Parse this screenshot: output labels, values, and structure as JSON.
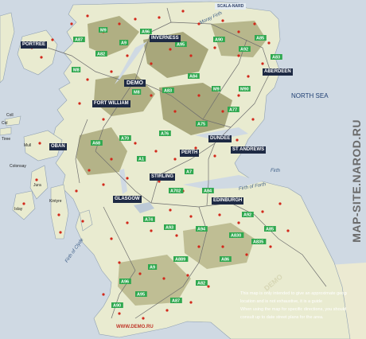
{
  "map": {
    "colors": {
      "sea": "#cfd9e3",
      "land": "#e9ebd0",
      "highland": "#9c9b6c",
      "road_label": "#2fa84f",
      "town_dot": "#d2281b",
      "city_label": "#1e2a44"
    },
    "cities": [
      {
        "id": "portree",
        "name": "PORTREE"
      },
      {
        "id": "inverness",
        "name": "INVERNESS"
      },
      {
        "id": "aberdeen",
        "name": "ABERDEEN"
      },
      {
        "id": "fort-william",
        "name": "FORT WILLIAM"
      },
      {
        "id": "oban",
        "name": "OBAN"
      },
      {
        "id": "perth",
        "name": "PERTH"
      },
      {
        "id": "dundee",
        "name": "DUNDEE"
      },
      {
        "id": "st-andrews",
        "name": "ST ANDREWS"
      },
      {
        "id": "stirling",
        "name": "STIRLING"
      },
      {
        "id": "glasgow",
        "name": "GLASGOW"
      },
      {
        "id": "edinburgh",
        "name": "EDINBURGH"
      }
    ],
    "demo_label": "DEMO",
    "sea_labels": {
      "north_sea": "NORTH SEA"
    },
    "firths": {
      "moray": "Moray Firth",
      "forth": "Firth of Forth",
      "clyde": "Firth of Clyde",
      "tay": "Firth"
    },
    "small_places": {
      "col": "Col",
      "mull": "Mull",
      "islay": "Islay",
      "jura": "Jura",
      "coll": "Coll",
      "tiree": "Tiree",
      "colonsay": "Colonsay",
      "kintyre": "Kintyre"
    },
    "top_box": "SCALA-NARD",
    "road_labels": [
      "A9",
      "A96",
      "A82",
      "A87",
      "A95",
      "A90",
      "A92",
      "A85",
      "A84",
      "A83",
      "M8",
      "M9",
      "M90",
      "A77",
      "A75",
      "A76",
      "A70",
      "A68",
      "A1",
      "A7",
      "A702",
      "A74",
      "A93",
      "A94",
      "A830",
      "A835",
      "A86",
      "A889"
    ],
    "watermark_side": "MAP-SITE.NAROD.RU",
    "watermark_bottom": "WWW.DEMO.RU",
    "watermark_diag": "DEMO",
    "disclaimer": [
      "This map is only intended to give an approximate geographic",
      "location and is not exhaustive, it is a guide",
      "When using the map for specific directions, you should",
      "consult up to date street plans for the area."
    ]
  }
}
